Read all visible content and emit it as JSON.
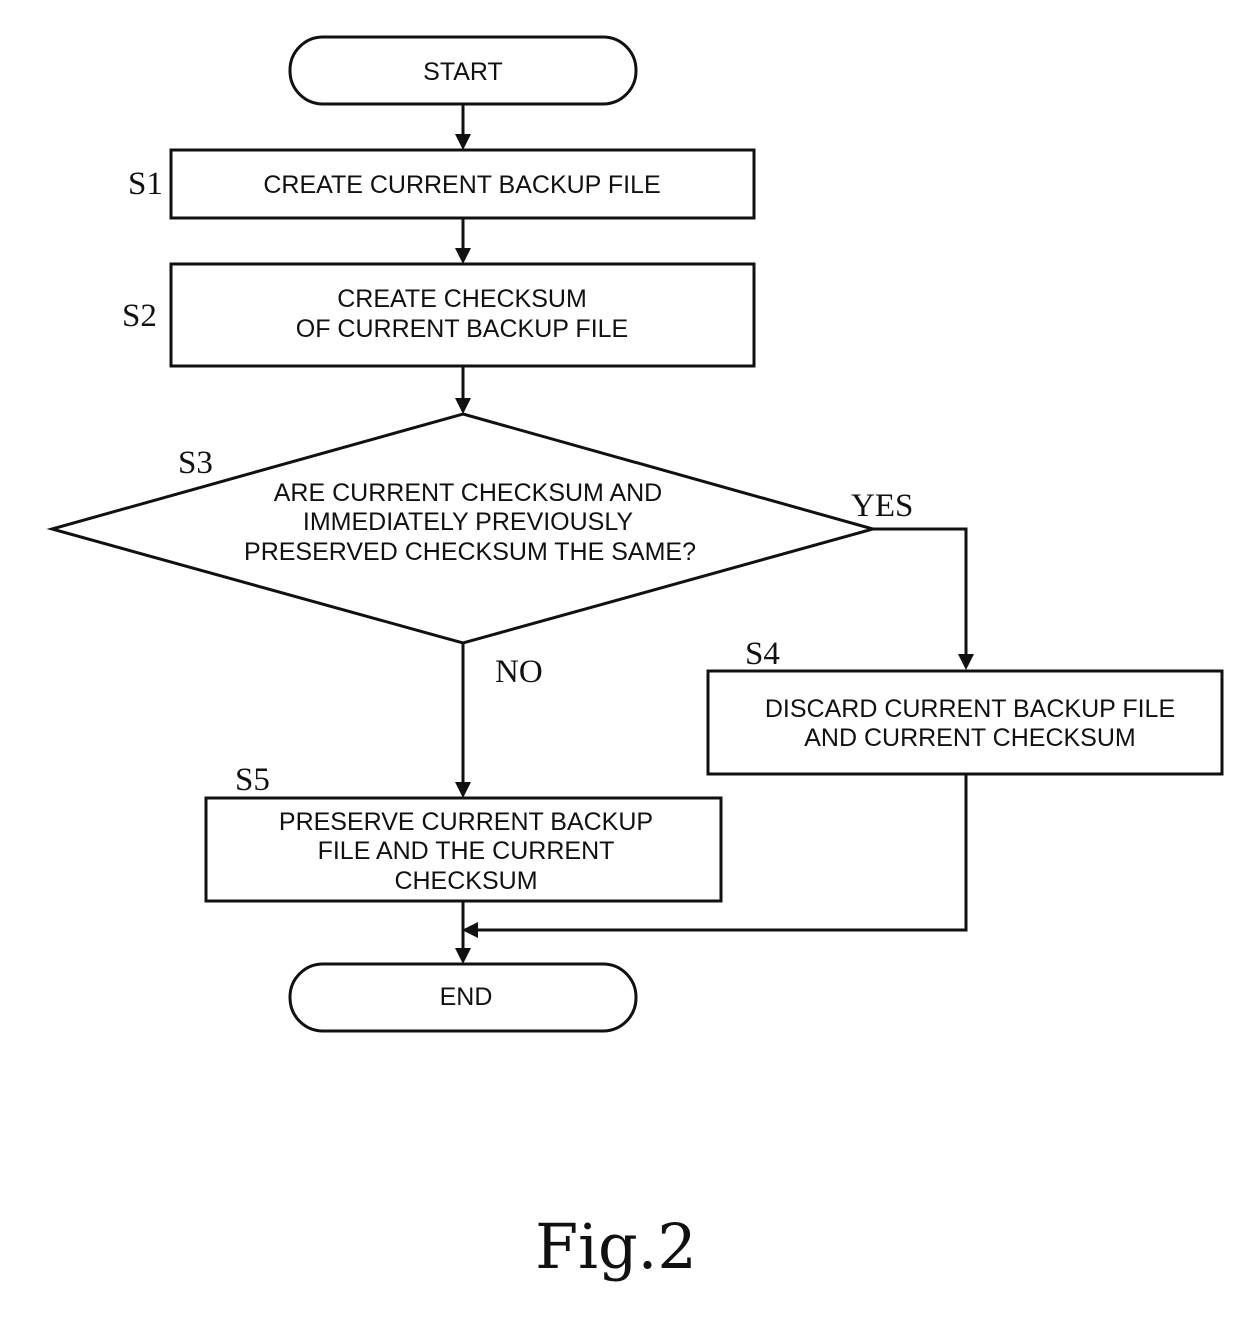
{
  "figure_label": "Fig.2",
  "nodes": {
    "start": {
      "text": [
        "START"
      ]
    },
    "s1": {
      "step": "S1",
      "text": [
        "CREATE CURRENT BACKUP FILE"
      ]
    },
    "s2": {
      "step": "S2",
      "text": [
        "CREATE CHECKSUM",
        "OF CURRENT BACKUP FILE"
      ]
    },
    "s3": {
      "step": "S3",
      "text": [
        "ARE CURRENT CHECKSUM AND",
        "IMMEDIATELY PREVIOUSLY",
        "PRESERVED CHECKSUM THE SAME?"
      ]
    },
    "s4": {
      "step": "S4",
      "text": [
        "DISCARD CURRENT BACKUP FILE",
        "AND CURRENT CHECKSUM"
      ]
    },
    "s5": {
      "step": "S5",
      "text": [
        "PRESERVE CURRENT BACKUP",
        "FILE AND THE CURRENT",
        "CHECKSUM"
      ]
    },
    "end": {
      "text": [
        "END"
      ]
    }
  },
  "branches": {
    "yes": "YES",
    "no": "NO"
  },
  "edges": [
    {
      "from": "start",
      "to": "s1"
    },
    {
      "from": "s1",
      "to": "s2"
    },
    {
      "from": "s2",
      "to": "s3"
    },
    {
      "from": "s3",
      "to": "s4",
      "label": "YES"
    },
    {
      "from": "s3",
      "to": "s5",
      "label": "NO"
    },
    {
      "from": "s5",
      "to": "end"
    },
    {
      "from": "s4",
      "to": "end"
    }
  ]
}
